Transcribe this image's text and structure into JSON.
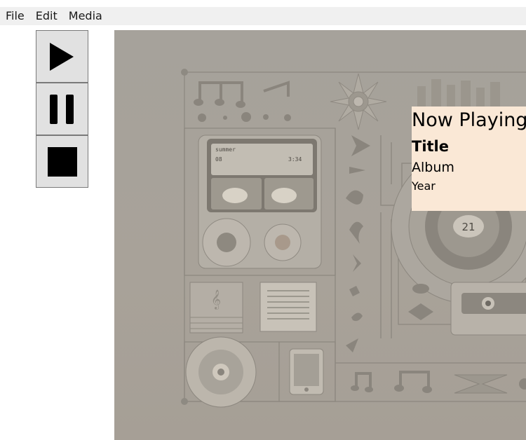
{
  "menubar": {
    "items": [
      {
        "label": "File"
      },
      {
        "label": "Edit"
      },
      {
        "label": "Media"
      }
    ]
  },
  "controls": {
    "play_icon": "play-icon",
    "pause_icon": "pause-icon",
    "stop_icon": "stop-icon"
  },
  "media": {
    "artwork_description_icon": "album-artwork",
    "record_label": "21",
    "device_screen_line1": "summer",
    "device_screen_line2": "08",
    "device_screen_time": "3:34"
  },
  "now_playing": {
    "heading": "Now Playing",
    "title": "Title",
    "album": "Album",
    "year": "Year"
  },
  "colors": {
    "menubar_bg": "#f0f0f0",
    "button_bg": "#e1e1e1",
    "overlay_bg": "#fae8d6",
    "media_tint": "#a9a39b"
  }
}
